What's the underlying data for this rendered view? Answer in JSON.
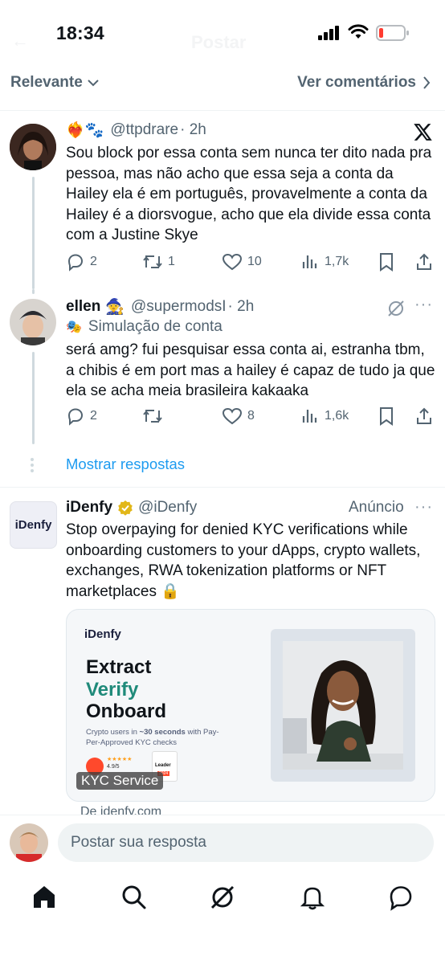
{
  "status_bar": {
    "time": "18:34",
    "faded_title": "Postar"
  },
  "sort_bar": {
    "sort_label": "Relevante",
    "view_label": "Ver comentários"
  },
  "posts": [
    {
      "emojis": "❤️‍🔥🐾",
      "handle": "@ttpdrare",
      "time": "· 2h",
      "text": "Sou block por essa conta sem nunca ter dito nada pra pessoa, mas não acho que essa seja a conta da Hailey ela é em português, provavelmente a conta da Hailey é a diorsvogue, acho que ela divide essa conta com a Justine Skye",
      "replies": "2",
      "reposts": "1",
      "likes": "10",
      "views": "1,7k"
    },
    {
      "name": "ellen",
      "name_emoji": "🧙",
      "handle": "@supermodsI",
      "time": "· 2h",
      "parody_emoji": "🎭",
      "parody_label": "Simulação de conta",
      "text": "será amg? fui pesquisar essa conta ai, estranha tbm, a chibis é em port mas a hailey é capaz de tudo ja que ela se acha meia brasileira kakaaka",
      "replies": "2",
      "reposts": "",
      "likes": "8",
      "views": "1,6k"
    }
  ],
  "show_replies": "Mostrar respostas",
  "ad": {
    "avatar_text": "iDenfy",
    "name": "iDenfy",
    "handle": "@iDenfy",
    "ad_label": "Anúncio",
    "text": "Stop overpaying for denied KYC verifications while onboarding customers to your dApps, crypto wallets, exchanges, RWA tokenization platforms or NFT marketplaces 🔒",
    "card": {
      "brand": "iDenfy",
      "line1": "Extract",
      "line2": "Verify",
      "line3": "Onboard",
      "sub_pre": "Crypto users in ",
      "sub_bold": "~30 seconds",
      "sub_post": " with Pay-Per-Approved KYC checks",
      "badge_label": "Leader",
      "badge_year": "2024",
      "stars": "★★★★★",
      "rating": "4.9/5",
      "tag": "KYC Service",
      "accent_color": "#1f8a7a"
    },
    "source": "De idenfy.com"
  },
  "reply_placeholder": "Postar sua resposta",
  "colors": {
    "link": "#1d9bf0",
    "secondary": "#536471",
    "verified": "#e2b719"
  }
}
